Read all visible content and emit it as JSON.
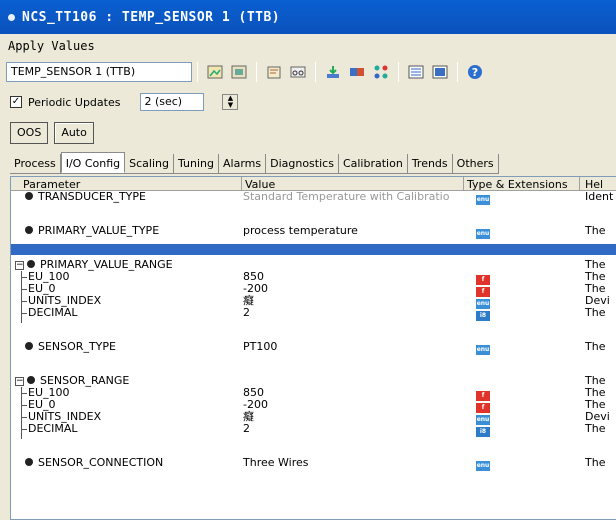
{
  "window": {
    "title": "NCS_TT106 : TEMP_SENSOR 1 (TTB)"
  },
  "menu": {
    "items": [
      "Apply Values"
    ]
  },
  "toolbar": {
    "block_selector": "TEMP_SENSOR 1 (TTB)"
  },
  "periodic": {
    "label": "Periodic Updates",
    "checked": true,
    "interval": "2 (sec)"
  },
  "mode": {
    "oos_label": "OOS",
    "auto_label": "Auto"
  },
  "tabs": [
    "Process",
    "I/O Config",
    "Scaling",
    "Tuning",
    "Alarms",
    "Diagnostics",
    "Calibration",
    "Trends",
    "Others"
  ],
  "active_tab": "I/O Config",
  "grid": {
    "columns": [
      "Parameter",
      "Value",
      "Type & Extensions",
      "Hel"
    ],
    "rows": [
      {
        "param": "TRANSDUCER_TYPE",
        "value": "Standard Temperature with Calibratio",
        "type": "enu",
        "help": "Ident"
      },
      {
        "param": "PRIMARY_VALUE_TYPE",
        "value": "process temperature",
        "type": "enu",
        "help": "The"
      },
      {
        "param": "PRIMARY_VALUE_RANGE",
        "value": "",
        "type": "",
        "help": "The"
      },
      {
        "param": "EU_100",
        "value": "850",
        "type": "f",
        "help": "The"
      },
      {
        "param": "EU_0",
        "value": "-200",
        "type": "f",
        "help": "The"
      },
      {
        "param": "UNITS_INDEX",
        "value": "癡",
        "type": "enu",
        "help": "Devi"
      },
      {
        "param": "DECIMAL",
        "value": "2",
        "type": "i8",
        "help": "The"
      },
      {
        "param": "SENSOR_TYPE",
        "value": "PT100",
        "type": "enu",
        "help": "The"
      },
      {
        "param": "SENSOR_RANGE",
        "value": "",
        "type": "",
        "help": "The"
      },
      {
        "param": "EU_100",
        "value": "850",
        "type": "f",
        "help": "The"
      },
      {
        "param": "EU_0",
        "value": "-200",
        "type": "f",
        "help": "The"
      },
      {
        "param": "UNITS_INDEX",
        "value": "癡",
        "type": "enu",
        "help": "Devi"
      },
      {
        "param": "DECIMAL",
        "value": "2",
        "type": "i8",
        "help": "The"
      },
      {
        "param": "SENSOR_CONNECTION",
        "value": "Three Wires",
        "type": "enu",
        "help": "The"
      }
    ]
  },
  "colors": {
    "title_bar": "#0b55c4",
    "selection": "#316ac5",
    "badge_enu": "#3a8fd6",
    "badge_float": "#e0332b"
  }
}
